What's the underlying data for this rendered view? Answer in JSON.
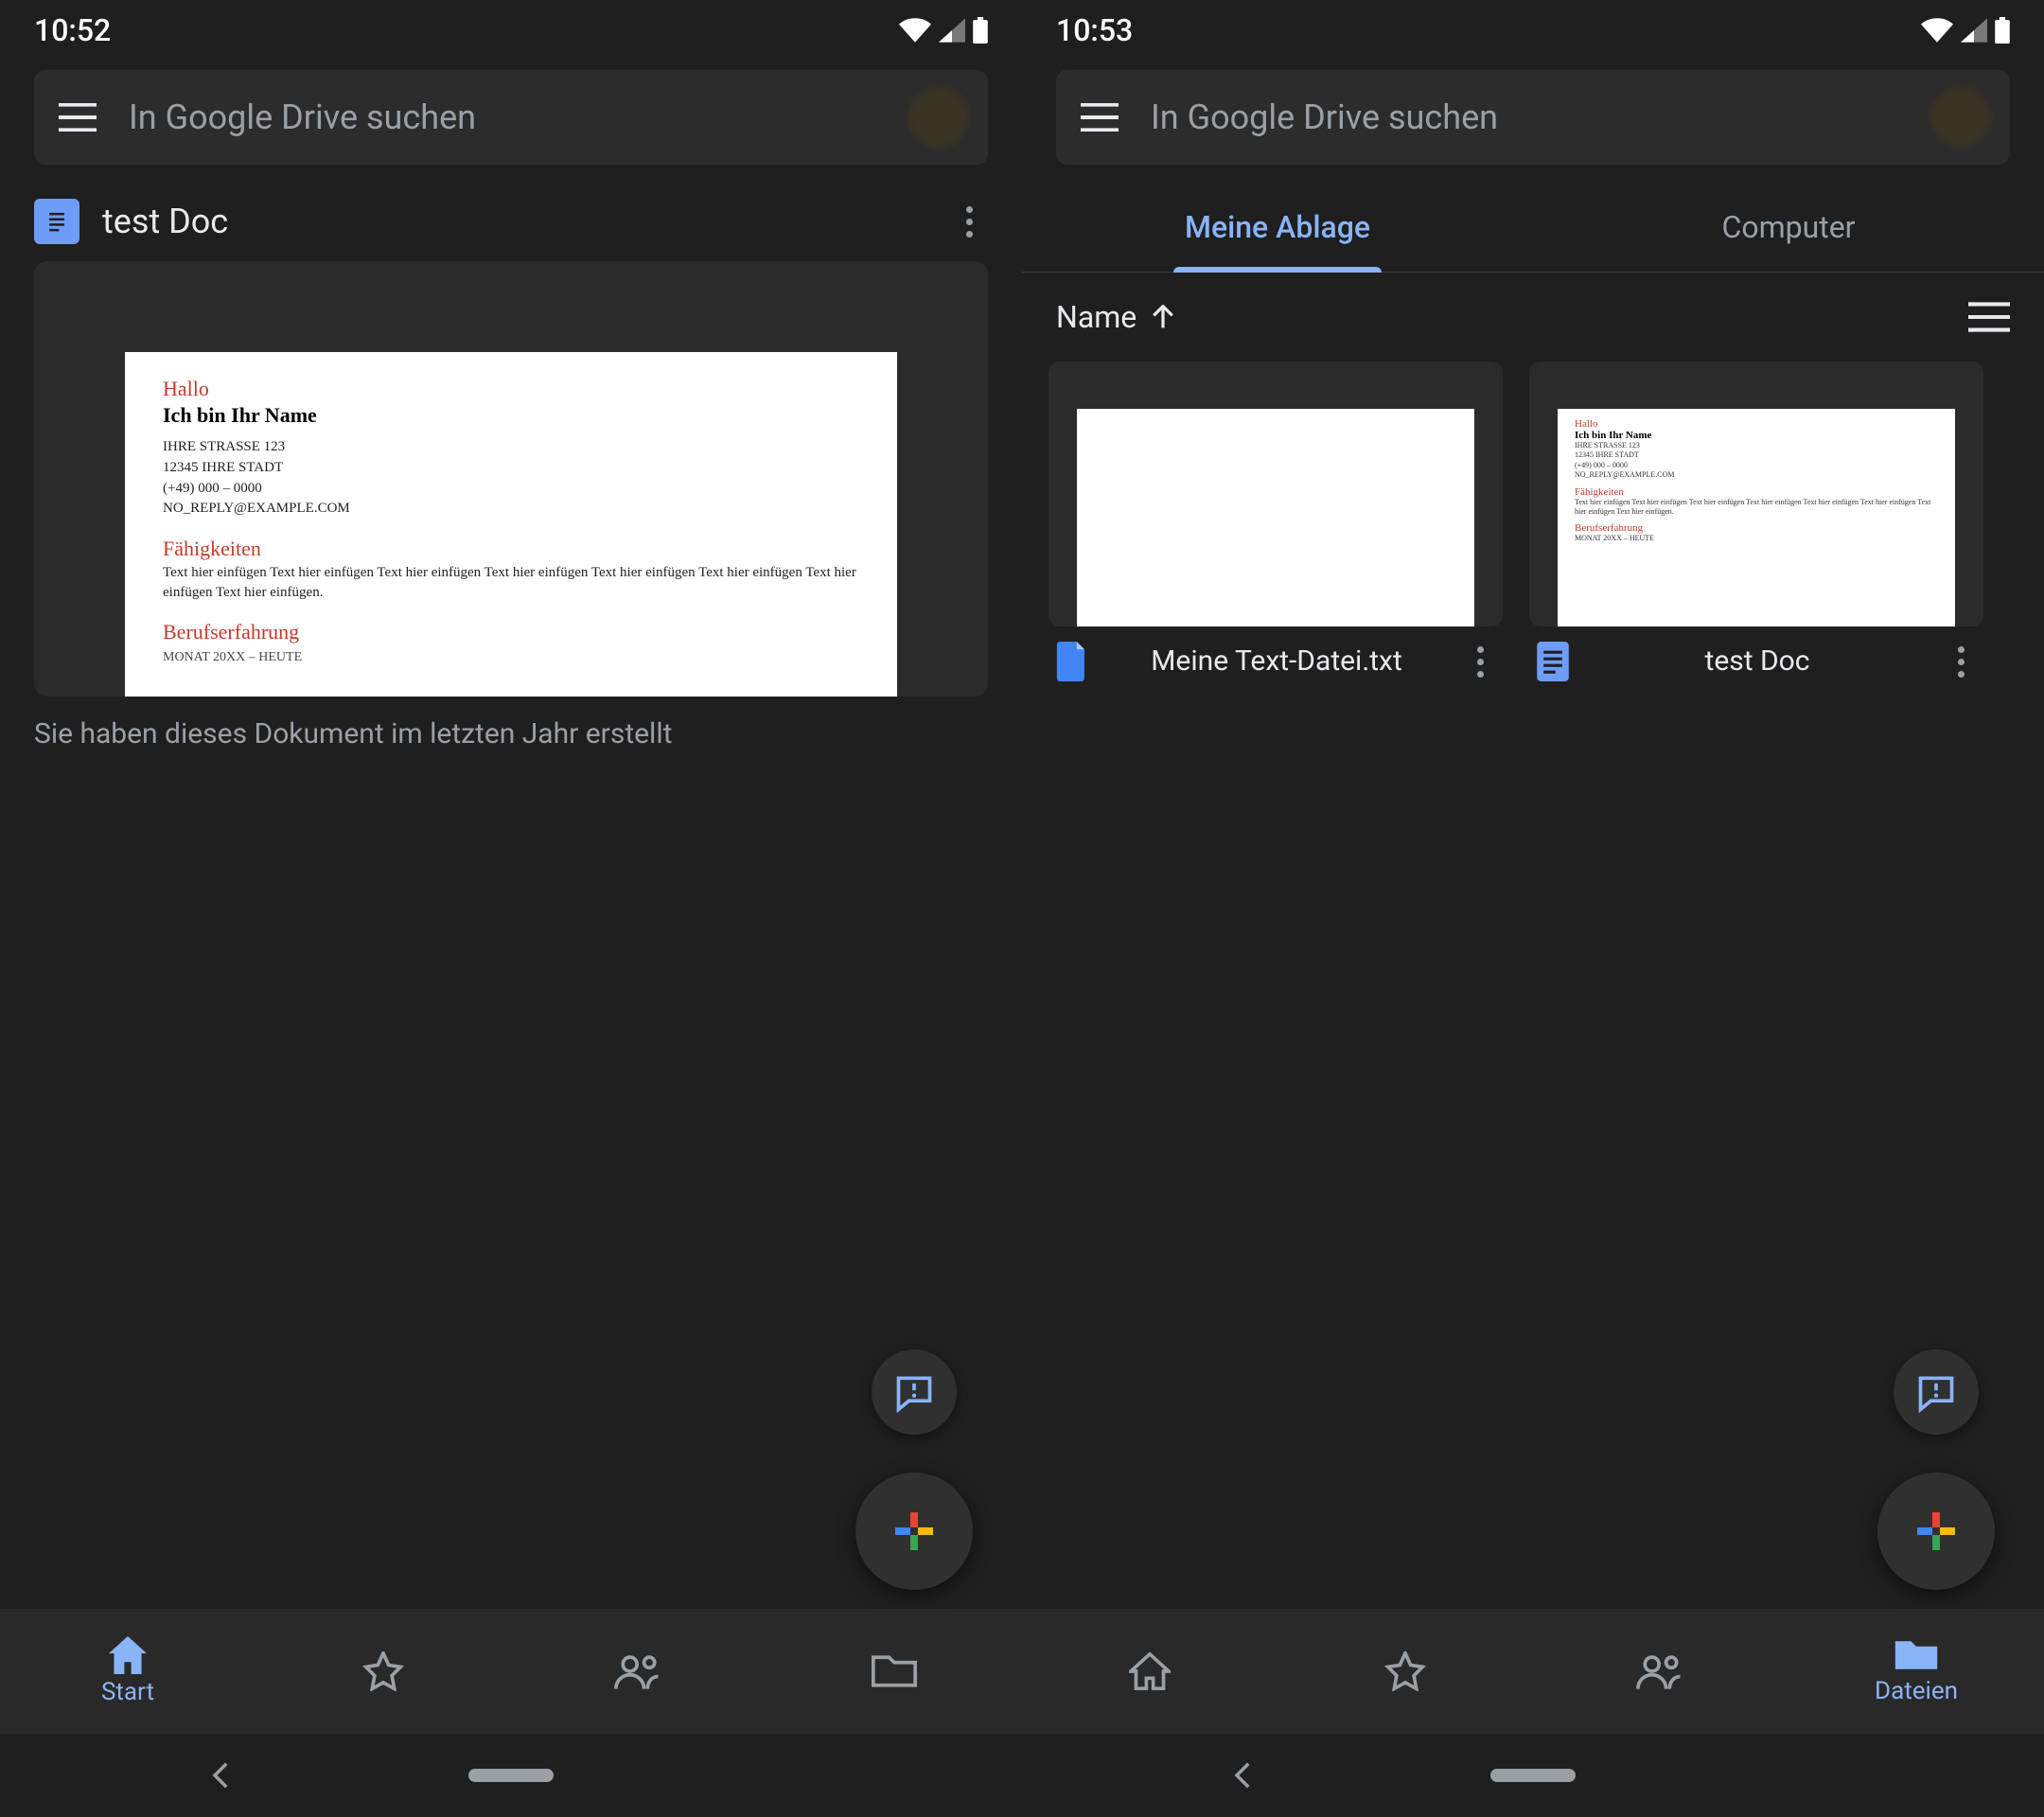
{
  "left": {
    "statusbar": {
      "time": "10:52"
    },
    "search": {
      "placeholder": "In Google Drive suchen"
    },
    "suggested": {
      "title": "test Doc",
      "caption": "Sie haben dieses Dokument im letzten Jahr erstellt",
      "preview": {
        "greeting": "Hallo",
        "name_line": "Ich bin Ihr Name",
        "address1": "IHRE STRASSE 123",
        "address2": "12345 IHRE STADT",
        "phone": "(+49) 000 – 0000",
        "email": "NO_REPLY@EXAMPLE.COM",
        "skills_heading": "Fähigkeiten",
        "skills_body": "Text hier einfügen Text hier einfügen Text hier einfügen Text hier einfügen Text hier einfügen Text hier einfügen Text hier einfügen Text hier einfügen.",
        "exp_heading": "Berufserfahrung",
        "exp_meta": "MONAT 20XX – HEUTE"
      }
    },
    "bottomnav": {
      "start": "Start",
      "active": "start"
    }
  },
  "right": {
    "statusbar": {
      "time": "10:53"
    },
    "search": {
      "placeholder": "In Google Drive suchen"
    },
    "tabs": {
      "mydrive": "Meine Ablage",
      "computer": "Computer",
      "active": "mydrive"
    },
    "sort": {
      "label": "Name"
    },
    "files": [
      {
        "name": "Meine Text-Datei.txt",
        "type": "file"
      },
      {
        "name": "test Doc",
        "type": "gdoc"
      }
    ],
    "bottomnav": {
      "files": "Dateien",
      "active": "files"
    }
  }
}
